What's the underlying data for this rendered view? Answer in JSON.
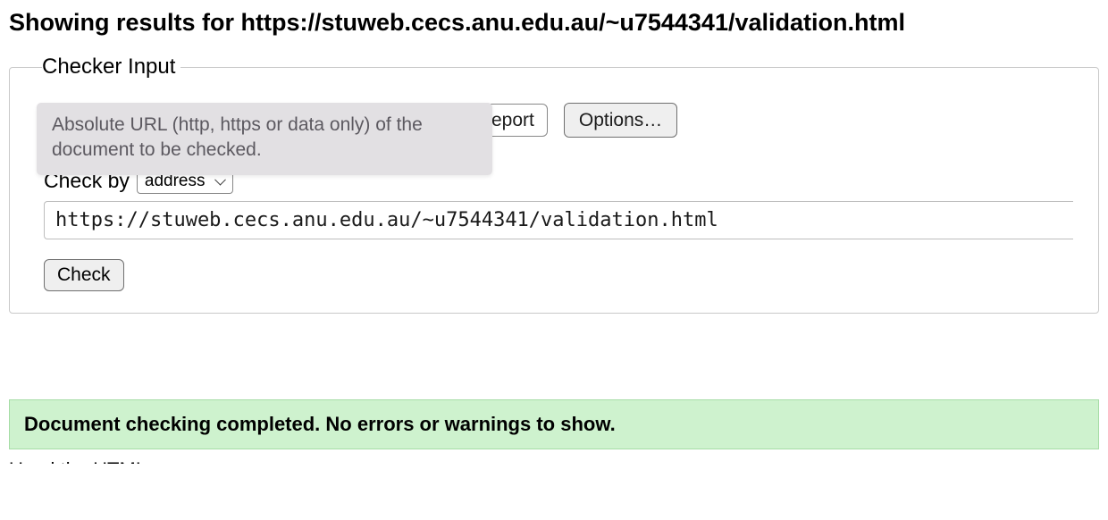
{
  "heading": "Showing results for https://stuweb.cecs.anu.edu.au/~u7544341/validation.html",
  "fieldset": {
    "legend": "Checker Input",
    "tooltip": "Absolute URL (http, https or data only) of the document to be checked.",
    "partial_button_visible_text": "eport",
    "options_button": "Options…",
    "checkby_label": "Check by",
    "checkby_selected": "address",
    "url_value": "https://stuweb.cecs.anu.edu.au/~u7544341/validation.html",
    "check_button": "Check"
  },
  "result_message": "Document checking completed. No errors or warnings to show.",
  "trailing_text": "Used the HTML"
}
